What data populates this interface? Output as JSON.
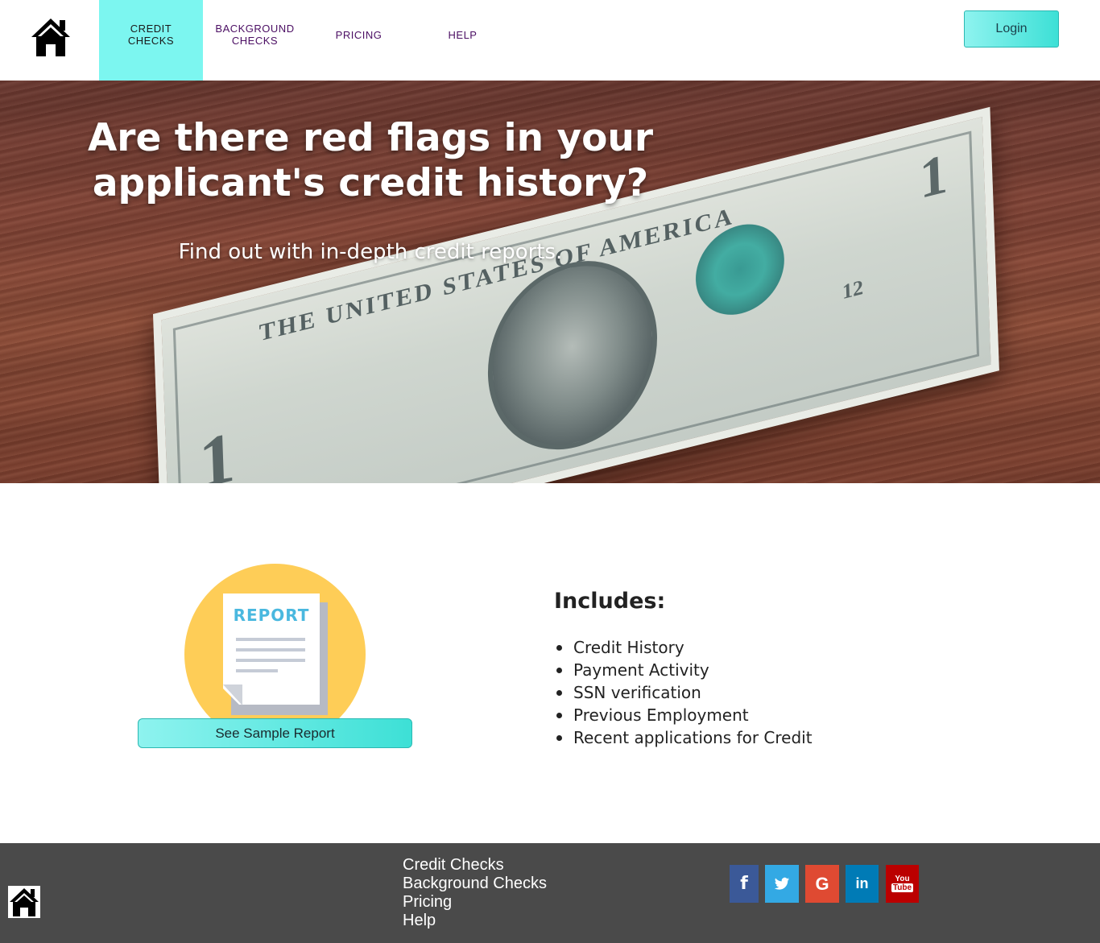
{
  "nav": {
    "items": [
      {
        "label_line1": "CREDIT",
        "label_line2": "CHECKS"
      },
      {
        "label_line1": "BACKGROUND",
        "label_line2": "CHECKS"
      },
      {
        "label_line1": "PRICING",
        "label_line2": ""
      },
      {
        "label_line1": "HELP",
        "label_line2": ""
      }
    ],
    "login_label": "Login",
    "active_color": "#7cf6f0",
    "link_color": "#4b0e63"
  },
  "hero": {
    "title_line1": "Are there red flags in your",
    "title_line2": "applicant's credit history?",
    "subtitle": "Find out with in-depth credit reports."
  },
  "report": {
    "doc_label": "REPORT",
    "button_label": "See Sample Report",
    "circle_color": "#fecd57",
    "label_color": "#4ab8df"
  },
  "includes": {
    "title": "Includes:",
    "items": [
      "Credit History",
      "Payment Activity",
      "SSN verification",
      "Previous Employment",
      "Recent applications for Credit"
    ]
  },
  "footer": {
    "links": [
      "Credit Checks",
      "Background Checks",
      "Pricing",
      "Help"
    ],
    "social": [
      {
        "icon": "facebook-icon",
        "glyph": "f",
        "color": "#3b5998"
      },
      {
        "icon": "twitter-icon",
        "glyph": "t",
        "color": "#33a9e4"
      },
      {
        "icon": "google-icon",
        "glyph": "G",
        "color": "#df4a32"
      },
      {
        "icon": "linkedin-icon",
        "glyph": "in",
        "color": "#007bb6"
      },
      {
        "icon": "youtube-icon",
        "glyph": "You Tube",
        "color": "#b00"
      }
    ],
    "background": "#4a4a4a"
  }
}
